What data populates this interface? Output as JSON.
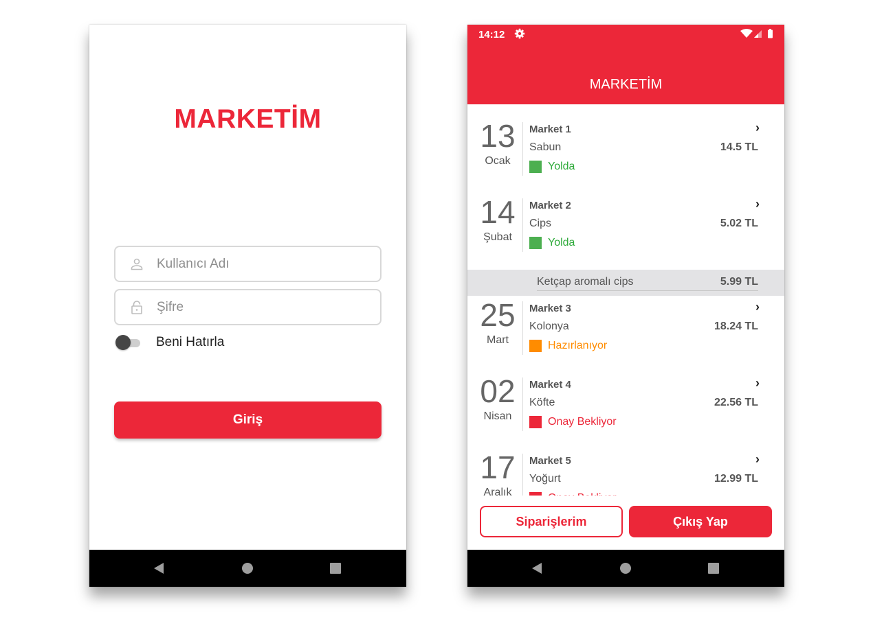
{
  "login": {
    "logo": "MARKETİM",
    "username": {
      "placeholder": "Kullanıcı Adı",
      "value": "",
      "icon": "person-icon"
    },
    "password": {
      "placeholder": "Şifre",
      "value": "",
      "icon": "lock-icon"
    },
    "remember_me": {
      "label": "Beni Hatırla",
      "checked": false
    },
    "login_button": "Giriş"
  },
  "orders_screen": {
    "status_bar": {
      "time": "14:12",
      "icons": [
        "settings-icon",
        "wifi-icon",
        "signal-icon",
        "battery-icon"
      ]
    },
    "title": "MARKETİM",
    "orders": [
      {
        "day": "13",
        "month": "Ocak",
        "market": "Market 1",
        "product": "Sabun",
        "price": "14.5 TL",
        "status": "Yolda",
        "status_color": "#4caf50",
        "status_text_color": "#2eaa3a"
      },
      {
        "day": "14",
        "month": "Şubat",
        "market": "Market 2",
        "product": "Cips",
        "price": "5.02 TL",
        "status": "Yolda",
        "status_color": "#4caf50",
        "status_text_color": "#2eaa3a"
      },
      {
        "day": "25",
        "month": "Mart",
        "market": "Market 3",
        "product": "Kolonya",
        "price": "18.24 TL",
        "status": "Hazırlanıyor",
        "status_color": "#ff8c00",
        "status_text_color": "#ff8c00"
      },
      {
        "day": "02",
        "month": "Nisan",
        "market": "Market 4",
        "product": "Köfte",
        "price": "22.56 TL",
        "status": "Onay Bekliyor",
        "status_color": "#ec2739",
        "status_text_color": "#ec2739"
      },
      {
        "day": "17",
        "month": "Aralık",
        "market": "Market 5",
        "product": "Yoğurt",
        "price": "12.99 TL",
        "status": "Onay Bekliyor",
        "status_color": "#ec2739",
        "status_text_color": "#ec2739"
      }
    ],
    "expanded_detail": {
      "product": "Ketçap aromalı cips",
      "price": "5.99 TL"
    },
    "orders_button": "Siparişlerim",
    "logout_button": "Çıkış Yap"
  },
  "colors": {
    "brand": "#ec2739",
    "nav_bar": "#000000"
  }
}
